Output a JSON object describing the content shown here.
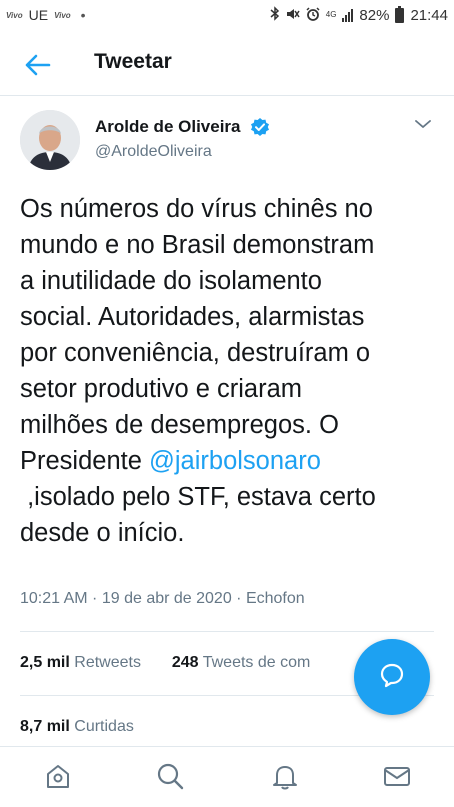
{
  "status_bar": {
    "mini_left_1": "Vivo",
    "carrier": "UE",
    "mini_left_2": "Vivo",
    "network": "4G",
    "battery": "82%",
    "time": "21:44"
  },
  "header": {
    "title": "Tweetar"
  },
  "author": {
    "name": "Arolde de Oliveira",
    "handle": "@AroldeOliveira"
  },
  "tweet": {
    "lines": [
      "Os números do vírus chinês no",
      "mundo e no Brasil demonstram",
      "a inutilidade do isolamento",
      "social. Autoridades, alarmistas",
      "por conveniência, destruíram o",
      "setor produtivo e criaram",
      "milhões de desempregos. O"
    ],
    "presidente_prefix": "Presidente ",
    "mention": "@jairbolsonaro",
    "line_after_mention": " ,isolado pelo STF, estava certo",
    "last_line": "desde o início."
  },
  "meta": {
    "time": "10:21 AM",
    "date": "19 de abr de 2020",
    "source": "Echofon",
    "separator": " · "
  },
  "stats": {
    "retweets_count": "2,5 mil",
    "retweets_label": "Retweets",
    "comments_count": "248",
    "comments_label": "Tweets de com"
  },
  "likes": {
    "count": "8,7 mil",
    "label": "Curtidas"
  },
  "colors": {
    "accent": "#1da1f2",
    "text": "#14171a",
    "secondary": "#657786",
    "divider": "#e1e8ed"
  },
  "icons": {
    "back": "arrow-left-icon",
    "verified": "verified-badge-icon",
    "caret": "chevron-down-icon",
    "fab": "compose-reply-icon",
    "nav": [
      "home-icon",
      "search-icon",
      "notifications-icon",
      "messages-icon"
    ]
  }
}
